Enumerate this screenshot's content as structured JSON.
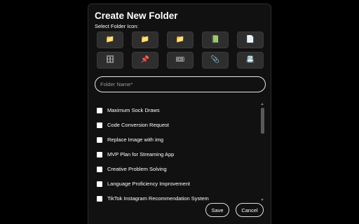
{
  "dialog": {
    "title": "Create New Folder",
    "icon_section_label": "Select Folder Icon:",
    "icons": [
      {
        "name": "folder-yellow-icon",
        "glyph": "📁"
      },
      {
        "name": "folder-yellow-icon-2",
        "glyph": "📁"
      },
      {
        "name": "folder-yellow-icon-3",
        "glyph": "📁"
      },
      {
        "name": "green-book-icon",
        "glyph": "📗"
      },
      {
        "name": "document-icon",
        "glyph": "📄"
      },
      {
        "name": "file-cabinet-icon",
        "glyph": "🗄"
      },
      {
        "name": "pushpin-icon",
        "glyph": "📌"
      },
      {
        "name": "red-ticket-icon",
        "glyph": "🎟"
      },
      {
        "name": "paperclip-icon",
        "glyph": "📎"
      },
      {
        "name": "card-index-icon",
        "glyph": "📇"
      }
    ],
    "name_placeholder": "Folder Name*",
    "name_value": "",
    "items": [
      "Maximum Sock Draws",
      "Code Conversion Request",
      "Replace Image with img",
      "MVP Plan for Streaming App",
      "Creative Problem Solving",
      "Language Proficiency Improvement",
      "TikTok Instagram Recommendation System"
    ],
    "save_label": "Save",
    "cancel_label": "Cancel"
  }
}
